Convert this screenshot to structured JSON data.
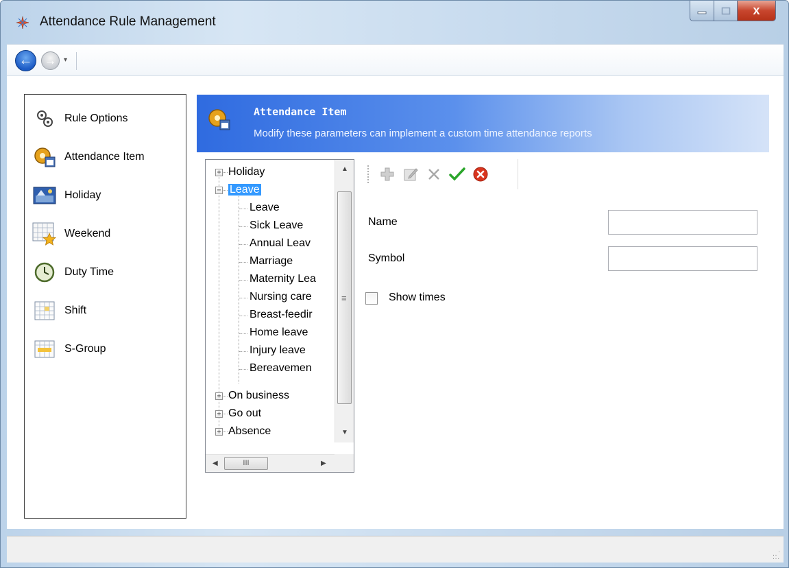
{
  "window": {
    "title": "Attendance Rule Management",
    "close_glyph": "x"
  },
  "nav": {
    "back_icon": "back-arrow-icon",
    "forward_icon": "forward-arrow-icon",
    "dropdown_glyph": "▾"
  },
  "sidebar": {
    "items": [
      {
        "label": "Rule Options",
        "icon": "gears-icon"
      },
      {
        "label": "Attendance Item",
        "icon": "gear-calendar-icon"
      },
      {
        "label": "Holiday",
        "icon": "holiday-picture-icon"
      },
      {
        "label": "Weekend",
        "icon": "calendar-star-icon"
      },
      {
        "label": "Duty Time",
        "icon": "clock-icon"
      },
      {
        "label": "Shift",
        "icon": "shift-grid-icon"
      },
      {
        "label": "S-Group",
        "icon": "schedule-group-icon"
      }
    ]
  },
  "header": {
    "title": "Attendance Item",
    "subtitle": "Modify these parameters can implement a custom time attendance reports"
  },
  "tree": {
    "nodes": [
      {
        "label": "Holiday",
        "expander": "+"
      },
      {
        "label": "Leave",
        "expander": "−",
        "selected": true
      },
      {
        "label": "Leave"
      },
      {
        "label": "Sick Leave"
      },
      {
        "label": "Annual Leav"
      },
      {
        "label": "Marriage"
      },
      {
        "label": "Maternity Lea"
      },
      {
        "label": "Nursing care"
      },
      {
        "label": "Breast-feedir"
      },
      {
        "label": "Home leave"
      },
      {
        "label": "Injury leave"
      },
      {
        "label": "Bereavemen"
      },
      {
        "label": "On business",
        "expander": "+"
      },
      {
        "label": "Go out",
        "expander": "+"
      },
      {
        "label": "Absence",
        "expander": "+"
      }
    ],
    "hscroll_grip": "III"
  },
  "toolbar": {
    "add_icon": "plus-icon",
    "edit_icon": "edit-icon",
    "delete_icon": "delete-x-icon",
    "save_icon": "checkmark-icon",
    "cancel_icon": "cancel-circle-icon"
  },
  "form": {
    "name_label": "Name",
    "name_value": "",
    "symbol_label": "Symbol",
    "symbol_value": "",
    "show_times_label": "Show times",
    "show_times_checked": false
  },
  "colors": {
    "header_start": "#2f6be0",
    "header_end": "#d5e3f8",
    "selection": "#3399ff",
    "save_green": "#2aa52a",
    "cancel_red": "#d9351f"
  }
}
